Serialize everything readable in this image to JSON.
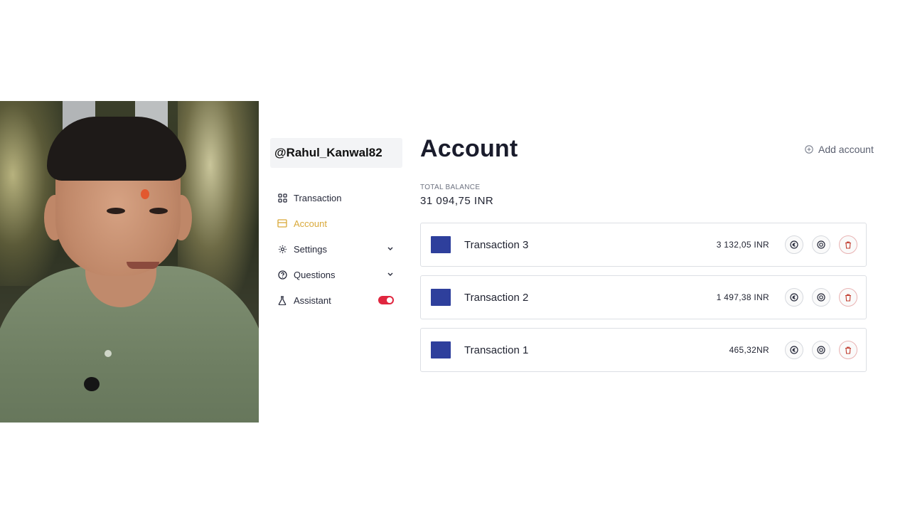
{
  "watermark": {
    "handle": "@Rahul_Kanwal82"
  },
  "sidebar": {
    "items": [
      {
        "label": "Transaction",
        "icon": "grid-icon",
        "active": false
      },
      {
        "label": "Account",
        "icon": "card-icon",
        "active": true
      },
      {
        "label": "Settings",
        "icon": "gear-icon",
        "expandable": true
      },
      {
        "label": "Questions",
        "icon": "question-icon",
        "expandable": true
      },
      {
        "label": "Assistant",
        "icon": "flask-icon",
        "toggle": true
      }
    ]
  },
  "main": {
    "title": "Account",
    "add_account_label": "Add account",
    "balance": {
      "label": "TOTAL BALANCE",
      "value": "31 094,75 INR"
    },
    "rows": [
      {
        "name": "Transaction 3",
        "amount": "3 132,05 INR"
      },
      {
        "name": "Transaction 2",
        "amount": "1 497,38 INR"
      },
      {
        "name": "Transaction 1",
        "amount": "465,32NR"
      }
    ]
  },
  "colors": {
    "accent": "#d9a93a",
    "card": "#2e3f9c",
    "toggle_on": "#e0263f",
    "delete": "#c0392b"
  }
}
